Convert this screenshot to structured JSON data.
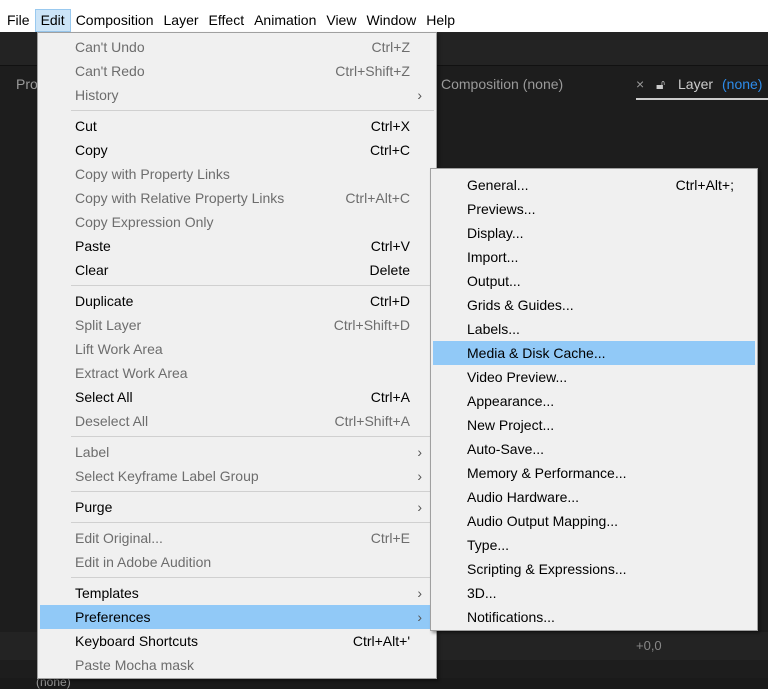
{
  "menubar": [
    "File",
    "Edit",
    "Composition",
    "Layer",
    "Effect",
    "Animation",
    "View",
    "Window",
    "Help"
  ],
  "panels": {
    "project_partial": "Pro",
    "composition": "Composition (none)",
    "layer_label": "Layer",
    "layer_value": "(none)",
    "bottom_partial": "(none)",
    "exposure": "+0,0"
  },
  "edit_menu": [
    [
      {
        "label": "Can't Undo",
        "shortcut": "Ctrl+Z",
        "disabled": true
      },
      {
        "label": "Can't Redo",
        "shortcut": "Ctrl+Shift+Z",
        "disabled": true
      },
      {
        "label": "History",
        "submenu": true,
        "disabled": true
      }
    ],
    [
      {
        "label": "Cut",
        "shortcut": "Ctrl+X"
      },
      {
        "label": "Copy",
        "shortcut": "Ctrl+C"
      },
      {
        "label": "Copy with Property Links",
        "shortcut": "",
        "disabled": true
      },
      {
        "label": "Copy with Relative Property Links",
        "shortcut": "Ctrl+Alt+C",
        "disabled": true
      },
      {
        "label": "Copy Expression Only",
        "disabled": true
      },
      {
        "label": "Paste",
        "shortcut": "Ctrl+V"
      },
      {
        "label": "Clear",
        "shortcut": "Delete"
      }
    ],
    [
      {
        "label": "Duplicate",
        "shortcut": "Ctrl+D"
      },
      {
        "label": "Split Layer",
        "shortcut": "Ctrl+Shift+D",
        "disabled": true
      },
      {
        "label": "Lift Work Area",
        "disabled": true
      },
      {
        "label": "Extract Work Area",
        "disabled": true
      },
      {
        "label": "Select All",
        "shortcut": "Ctrl+A"
      },
      {
        "label": "Deselect All",
        "shortcut": "Ctrl+Shift+A",
        "disabled": true
      }
    ],
    [
      {
        "label": "Label",
        "submenu": true,
        "disabled": true
      },
      {
        "label": "Select Keyframe Label Group",
        "submenu": true,
        "disabled": true
      }
    ],
    [
      {
        "label": "Purge",
        "submenu": true
      }
    ],
    [
      {
        "label": "Edit Original...",
        "shortcut": "Ctrl+E",
        "disabled": true
      },
      {
        "label": "Edit in Adobe Audition",
        "disabled": true
      }
    ],
    [
      {
        "label": "Templates",
        "submenu": true
      },
      {
        "label": "Preferences",
        "submenu": true,
        "highlighted": true
      },
      {
        "label": "Keyboard Shortcuts",
        "shortcut": "Ctrl+Alt+'"
      },
      {
        "label": "Paste Mocha mask",
        "disabled": true
      }
    ]
  ],
  "preferences_submenu": [
    {
      "label": "General...",
      "shortcut": "Ctrl+Alt+;"
    },
    {
      "label": "Previews..."
    },
    {
      "label": "Display..."
    },
    {
      "label": "Import..."
    },
    {
      "label": "Output..."
    },
    {
      "label": "Grids & Guides..."
    },
    {
      "label": "Labels..."
    },
    {
      "label": "Media & Disk Cache...",
      "highlighted": true
    },
    {
      "label": "Video Preview..."
    },
    {
      "label": "Appearance..."
    },
    {
      "label": "New Project..."
    },
    {
      "label": "Auto-Save..."
    },
    {
      "label": "Memory & Performance..."
    },
    {
      "label": "Audio Hardware..."
    },
    {
      "label": "Audio Output Mapping..."
    },
    {
      "label": "Type..."
    },
    {
      "label": "Scripting & Expressions..."
    },
    {
      "label": "3D..."
    },
    {
      "label": "Notifications..."
    }
  ],
  "colors": {
    "highlight": "#91c9f7",
    "menu_bg": "#f0f0f0",
    "accent": "#2d8ceb"
  }
}
